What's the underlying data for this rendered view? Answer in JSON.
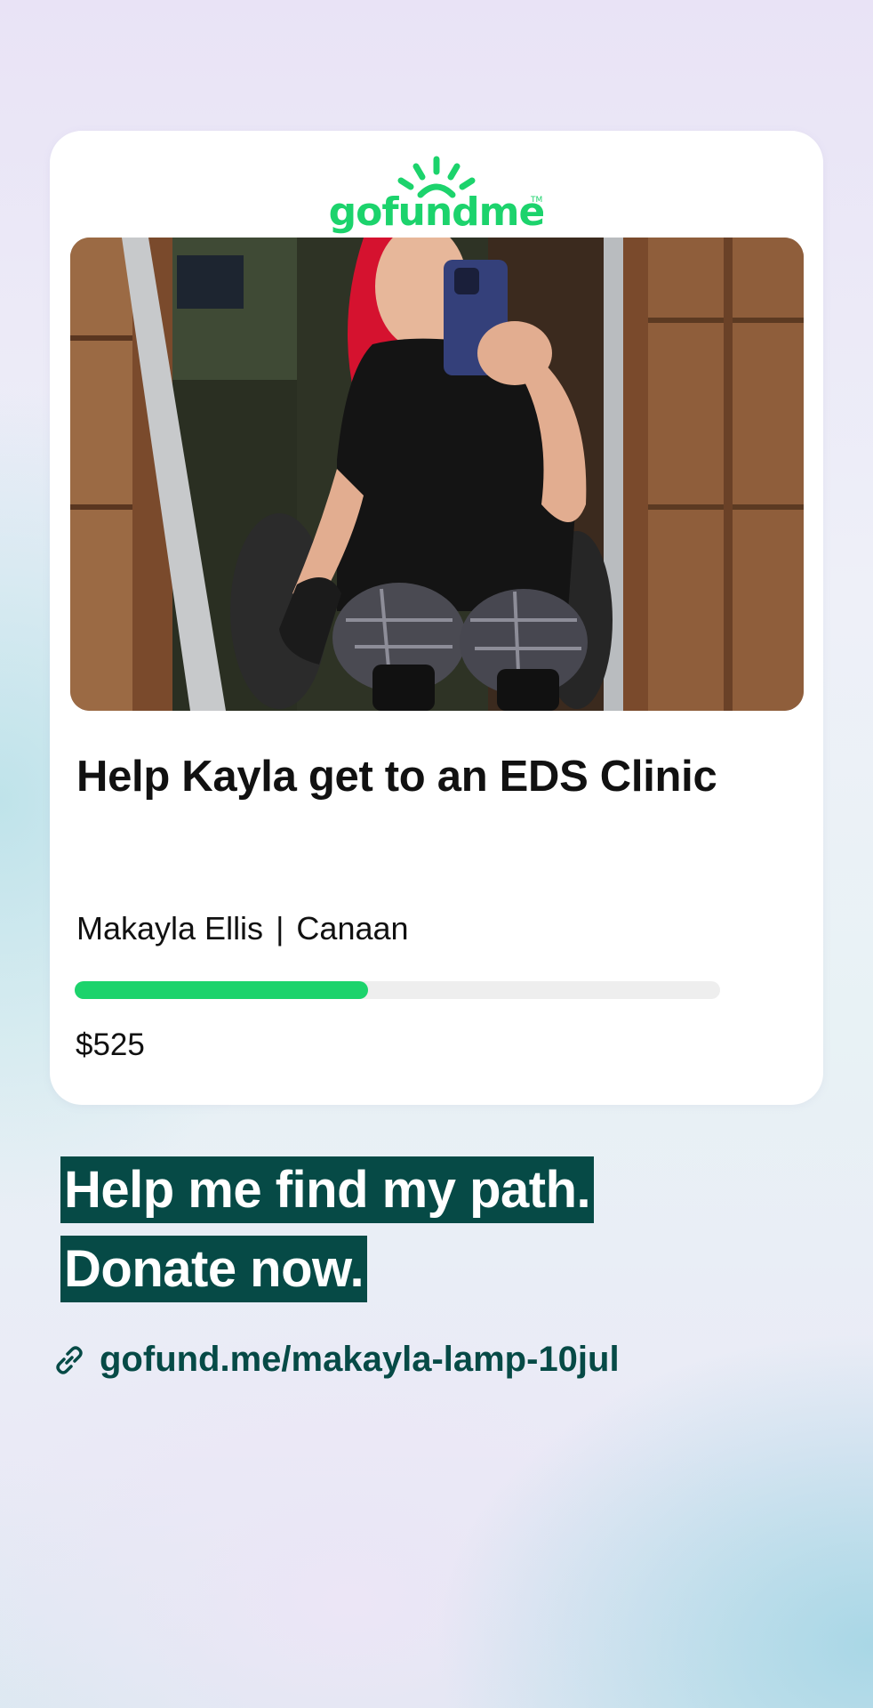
{
  "brand": {
    "logo_text": "gofundme",
    "accent_color": "#1cd36c",
    "dark_color": "#064a46"
  },
  "campaign": {
    "photo_icon": "photo",
    "title": "Help Kayla get to an EDS Clinic",
    "organizer": "Makayla Ellis",
    "separator": "|",
    "location": "Canaan",
    "progress_fraction": 0.455,
    "amount_raised": "$525"
  },
  "cta": {
    "line1": "Help me find my path.",
    "line2": "Donate now."
  },
  "link": {
    "icon": "link-icon",
    "text": "gofund.me/makayla-lamp-10jul"
  }
}
